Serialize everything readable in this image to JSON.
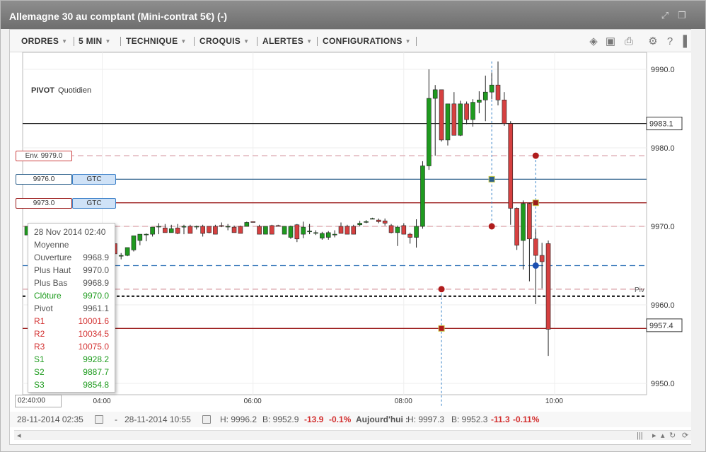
{
  "window": {
    "title": "Allemagne 30 au comptant (Mini-contrat 5€) (-)"
  },
  "toolbar": {
    "menus": [
      {
        "label": "ORDRES"
      },
      {
        "label": "5 MIN"
      },
      {
        "label": "TECHNIQUE"
      },
      {
        "label": "CROQUIS"
      },
      {
        "label": "ALERTES"
      },
      {
        "label": "CONFIGURATIONS"
      }
    ],
    "icons": [
      "layers-icon",
      "image-icon",
      "print-icon",
      "gear-icon",
      "help-icon",
      "pin-icon"
    ]
  },
  "indicator": {
    "name": "PIVOT",
    "period": "Quotidien"
  },
  "chart_data": {
    "type": "candlestick",
    "ylim": [
      9947.0,
      9992.0
    ],
    "y_ticks": [
      9950.0,
      9960.0,
      9970.0,
      9980.0,
      9990.0
    ],
    "y_tick_labels": [
      "9950.0",
      "9960.0",
      "9970.0",
      "9980.0",
      "9990.0"
    ],
    "x_ticks": [
      {
        "label": "04:00",
        "bar": 12
      },
      {
        "label": "06:00",
        "bar": 36
      },
      {
        "label": "08:00",
        "bar": 60
      },
      {
        "label": "10:00",
        "bar": 84
      }
    ],
    "first_bar_time": "02:40",
    "bar_interval_min": 5,
    "candles": [
      [
        9968.9,
        9970.0,
        9968.9,
        9970.0
      ],
      [
        9967.3,
        9969.5,
        9967.0,
        9967.5
      ],
      [
        9967.0,
        9969.3,
        9966.7,
        9967.8
      ],
      [
        9968.2,
        9968.8,
        9966.2,
        9967.1
      ],
      [
        9966.8,
        9967.5,
        9966.3,
        9967.5
      ],
      [
        9968.0,
        9968.2,
        9966.6,
        9967.0
      ],
      [
        9967.2,
        9968.0,
        9966.1,
        9966.3
      ],
      [
        9967.7,
        9968.9,
        9967.3,
        9967.6
      ],
      [
        9968.2,
        9968.8,
        9967.8,
        9967.9
      ],
      [
        9968.8,
        9969.2,
        9967.6,
        9968.1
      ],
      [
        9968.4,
        9969.0,
        9967.3,
        9967.6
      ],
      [
        9968.7,
        9968.9,
        9967.8,
        9968.4
      ],
      [
        9968.6,
        9968.8,
        9968.0,
        9968.2
      ],
      [
        9967.8,
        9968.9,
        9967.2,
        9966.5
      ],
      [
        9967.8,
        9968.7,
        9966.4,
        9966.5
      ],
      [
        9966.2,
        9966.6,
        9965.8,
        9966.3
      ],
      [
        9966.3,
        9967.3,
        9966.2,
        9967.3
      ],
      [
        9967.0,
        9968.8,
        9966.8,
        9968.8
      ],
      [
        9968.2,
        9968.6,
        9967.6,
        9969.0
      ],
      [
        9969.0,
        9969.1,
        9968.1,
        9969.0
      ],
      [
        9969.0,
        9969.3,
        9968.7,
        9969.9
      ],
      [
        9970.0,
        9970.4,
        9969.0,
        9970.0
      ],
      [
        9969.8,
        9970.3,
        9969.5,
        9969.2
      ],
      [
        9969.2,
        9970.2,
        9969.2,
        9969.7
      ],
      [
        9969.8,
        9970.3,
        9969.0,
        9969.1
      ],
      [
        9969.9,
        9970.2,
        9969.0,
        9970.0
      ],
      [
        9970.0,
        9970.2,
        9969.1,
        9969.1
      ],
      [
        9970.0,
        9970.1,
        9969.6,
        9970.0
      ],
      [
        9970.0,
        9970.2,
        9968.7,
        9969.1
      ],
      [
        9970.0,
        9970.0,
        9969.1,
        9969.2
      ],
      [
        9970.0,
        9970.2,
        9969.0,
        9969.0
      ],
      [
        9970.1,
        9970.5,
        9969.9,
        9970.0
      ],
      [
        9970.0,
        9970.3,
        9969.5,
        9970.0
      ],
      [
        9969.9,
        9970.1,
        9969.2,
        9969.2
      ],
      [
        9970.0,
        9970.1,
        9969.2,
        9969.1
      ],
      [
        9970.0,
        9970.6,
        9970.0,
        9970.5
      ],
      [
        9970.6,
        9970.6,
        9970.5,
        9970.5
      ],
      [
        9970.0,
        9970.2,
        9969.0,
        9969.0
      ],
      [
        9969.0,
        9970.0,
        9969.0,
        9970.0
      ],
      [
        9970.1,
        9970.2,
        9969.1,
        9969.0
      ],
      [
        9970.1,
        9970.2,
        9970.0,
        9970.0
      ],
      [
        9969.0,
        9970.0,
        9969.0,
        9970.0
      ],
      [
        9968.6,
        9970.1,
        9968.4,
        9970.0
      ],
      [
        9970.2,
        9970.3,
        9968.0,
        9968.4
      ],
      [
        9969.0,
        9970.6,
        9968.5,
        9969.9
      ],
      [
        9969.3,
        9970.3,
        9969.0,
        9969.4
      ],
      [
        9969.2,
        9969.5,
        9968.9,
        9969.2
      ],
      [
        9968.5,
        9969.3,
        9968.3,
        9969.1
      ],
      [
        9968.6,
        9969.4,
        9968.3,
        9969.2
      ],
      [
        9968.9,
        9969.5,
        9968.6,
        9969.0
      ],
      [
        9970.0,
        9970.5,
        9969.2,
        9969.1
      ],
      [
        9970.0,
        9970.2,
        9969.1,
        9969.0
      ],
      [
        9970.0,
        9970.2,
        9969.0,
        9969.0
      ],
      [
        9970.2,
        9970.7,
        9970.0,
        9970.4
      ],
      [
        9970.6,
        9970.8,
        9970.4,
        9970.6
      ],
      [
        9971.0,
        9971.1,
        9970.9,
        9971.0
      ],
      [
        9970.8,
        9971.0,
        9970.4,
        9970.6
      ],
      [
        9970.7,
        9971.0,
        9970.1,
        9970.4
      ],
      [
        9970.1,
        9970.3,
        9969.1,
        9969.2
      ],
      [
        9969.2,
        9970.1,
        9967.5,
        9969.9
      ],
      [
        9970.1,
        9970.4,
        9969.1,
        9969.0
      ],
      [
        9969.0,
        9969.2,
        9967.8,
        9968.6
      ],
      [
        9968.6,
        9970.9,
        9967.3,
        9970.0
      ],
      [
        9970.0,
        9978.3,
        9969.7,
        9977.7
      ],
      [
        9977.7,
        9990.0,
        9977.2,
        9986.3
      ],
      [
        9986.3,
        9988.0,
        9979.0,
        9987.4
      ],
      [
        9987.4,
        9986.9,
        9980.8,
        9981.0
      ],
      [
        9981.0,
        9985.6,
        9980.3,
        9985.6
      ],
      [
        9985.6,
        9987.1,
        9981.7,
        9981.6
      ],
      [
        9981.6,
        9986.0,
        9981.5,
        9985.6
      ],
      [
        9985.6,
        9985.9,
        9983.0,
        9983.6
      ],
      [
        9983.6,
        9986.2,
        9982.7,
        9985.8
      ],
      [
        9985.8,
        9987.2,
        9984.4,
        9986.1
      ],
      [
        9986.1,
        9989.2,
        9983.4,
        9987.1
      ],
      [
        9987.1,
        9989.6,
        9986.2,
        9988.0
      ],
      [
        9988.0,
        9991.0,
        9985.4,
        9986.1
      ],
      [
        9986.1,
        9987.1,
        9982.8,
        9983.1
      ],
      [
        9983.1,
        9983.4,
        9970.2,
        9972.3
      ],
      [
        9972.3,
        9972.4,
        9967.0,
        9967.6
      ],
      [
        9968.2,
        9973.3,
        9964.5,
        9972.9
      ],
      [
        9972.9,
        9973.0,
        9963.0,
        9968.4
      ],
      [
        9968.4,
        9969.6,
        9960.1,
        9966.3
      ],
      [
        9966.3,
        9967.9,
        9962.1,
        9965.5
      ],
      [
        9967.8,
        9968.2,
        9953.5,
        9956.9
      ]
    ],
    "horizontal_lines": [
      {
        "value": 9983.1,
        "color": "#222222",
        "style": "solid"
      },
      {
        "value": 9979.0,
        "color": "#d9a0a8",
        "style": "dashed"
      },
      {
        "value": 9976.0,
        "color": "#2b5f8b",
        "style": "solid"
      },
      {
        "value": 9973.0,
        "color": "#9b1b1b",
        "style": "solid"
      },
      {
        "value": 9970.0,
        "color": "#d9a0a8",
        "style": "dashed"
      },
      {
        "value": 9965.0,
        "color": "#2b6fb6",
        "style": "dashed"
      },
      {
        "value": 9962.0,
        "color": "#d9a0a8",
        "style": "dashed"
      },
      {
        "value": 9961.1,
        "color": "#000000",
        "style": "dashed-bold"
      },
      {
        "value": 9957.0,
        "color": "#9b1b1b",
        "style": "solid"
      }
    ],
    "price_tags": [
      {
        "label": "9983.1",
        "value": 9983.1
      },
      {
        "label": "9957.4",
        "value": 9957.4
      }
    ],
    "pivot_tag": "Piv",
    "order_markers": [
      {
        "bar": 74,
        "value": 9976.0,
        "shape": "square",
        "color": "#2b5f8b"
      },
      {
        "bar": 74,
        "value": 9970.0,
        "shape": "circle",
        "color": "#b01c1c"
      },
      {
        "bar": 81,
        "value": 9979.0,
        "shape": "circle",
        "color": "#b01c1c"
      },
      {
        "bar": 81,
        "value": 9973.0,
        "shape": "square",
        "color": "#9b1b1b"
      },
      {
        "bar": 81,
        "value": 9965.0,
        "shape": "circle",
        "color": "#1c4fb0"
      },
      {
        "bar": 66,
        "value": 9962.0,
        "shape": "circle",
        "color": "#b01c1c"
      },
      {
        "bar": 66,
        "value": 9957.0,
        "shape": "square",
        "color": "#b01c1c"
      }
    ]
  },
  "line_labels": [
    {
      "text": "Env. 9979.0",
      "value": 9979.0
    },
    {
      "text": "9976.0",
      "value": 9976.0,
      "tag": "GTC"
    },
    {
      "text": "9973.0",
      "value": 9973.0,
      "tag": "GTC"
    }
  ],
  "tooltip": {
    "date": "28 Nov 2014 02:40",
    "title": "Moyenne",
    "rows": [
      {
        "label": "Ouverture",
        "value": "9968.9",
        "color": ""
      },
      {
        "label": "Plus Haut",
        "value": "9970.0",
        "color": ""
      },
      {
        "label": "Plus Bas",
        "value": "9968.9",
        "color": ""
      },
      {
        "label": "Clôture",
        "value": "9970.0",
        "color": "green"
      },
      {
        "label": "Pivot",
        "value": "9961.1",
        "color": ""
      },
      {
        "label": "R1",
        "value": "10001.6",
        "color": "red"
      },
      {
        "label": "R2",
        "value": "10034.5",
        "color": "red"
      },
      {
        "label": "R3",
        "value": "10075.0",
        "color": "red"
      },
      {
        "label": "S1",
        "value": "9928.2",
        "color": "green"
      },
      {
        "label": "S2",
        "value": "9887.7",
        "color": "green"
      },
      {
        "label": "S3",
        "value": "9854.8",
        "color": "green"
      }
    ]
  },
  "time_input": {
    "value": "02:40:00"
  },
  "status": {
    "from": "28-11-2014 02:35",
    "dash": "-",
    "to": "28-11-2014 10:55",
    "high": "H: 9996.2",
    "low": "B: 9952.9",
    "change": "-13.9",
    "change_pct": "-0.1%",
    "today_label": "Aujourd'hui :",
    "today_high": "H: 9997.3",
    "today_low": "B: 9952.3",
    "today_change": "-11.3",
    "today_change_pct": "-0.11%"
  },
  "colors": {
    "up": "#1f9a1f",
    "down": "#d64040",
    "accent_red": "#d33131"
  }
}
